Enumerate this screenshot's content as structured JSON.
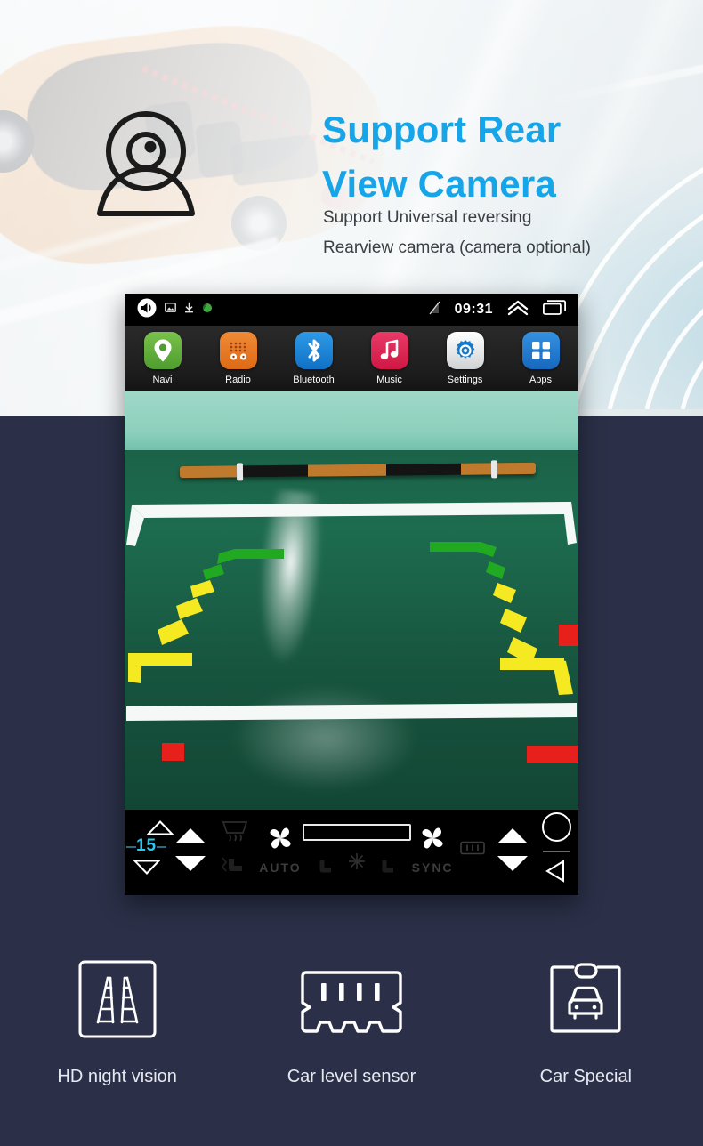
{
  "hero": {
    "title_line1": "Support Rear",
    "title_line2": "View Camera",
    "sub_line1": "Support Universal reversing",
    "sub_line2": "Rearview camera (camera optional)",
    "title_color": "#15a5e8",
    "sub_color": "#3b3f44",
    "camera_icon": "webcam-icon"
  },
  "device": {
    "statusbar": {
      "clock": "09:31",
      "left_icons": [
        "volume-icon",
        "screenshot-icon",
        "download-icon",
        "notification-icon"
      ],
      "right_icons": [
        "signal-off-icon",
        "chevron-up-icon",
        "recent-apps-icon"
      ]
    },
    "dock": {
      "apps": [
        {
          "label": "Navi",
          "icon": "map-pin-icon",
          "color": "#5aa83a"
        },
        {
          "label": "Radio",
          "icon": "radio-icon",
          "color": "#e8751f"
        },
        {
          "label": "Bluetooth",
          "icon": "bluetooth-icon",
          "color": "#1a86d6"
        },
        {
          "label": "Music",
          "icon": "music-note-icon",
          "color": "#e0285a"
        },
        {
          "label": "Settings",
          "icon": "gear-icon",
          "color": "#e9e9e9"
        },
        {
          "label": "Apps",
          "icon": "grid-icon",
          "color": "#1f7fd4"
        }
      ]
    },
    "camera_view": {
      "description": "Rear view camera feed showing green floor with white parking box",
      "guide_colors": {
        "near": "#e8201c",
        "mid": "#f5e921",
        "far": "#21aa21"
      }
    },
    "hvac": {
      "temperature": "15",
      "temperature_color": "#2ec7f0",
      "auto_label": "AUTO",
      "sync_label": "SYNC",
      "icons": [
        "fan-icon",
        "defrost-front-icon",
        "defrost-rear-icon",
        "snowflake-icon",
        "seat-heat-icon",
        "home-icon",
        "back-icon"
      ]
    }
  },
  "features": [
    {
      "label": "HD night vision",
      "icon": "parking-lines-icon"
    },
    {
      "label": "Car level sensor",
      "icon": "level-sensor-icon"
    },
    {
      "label": "Car Special",
      "icon": "car-front-icon"
    }
  ],
  "theme": {
    "page_background": "#2b3048",
    "hero_background": "#e6ecef",
    "accent_blue": "#15a5e8"
  }
}
